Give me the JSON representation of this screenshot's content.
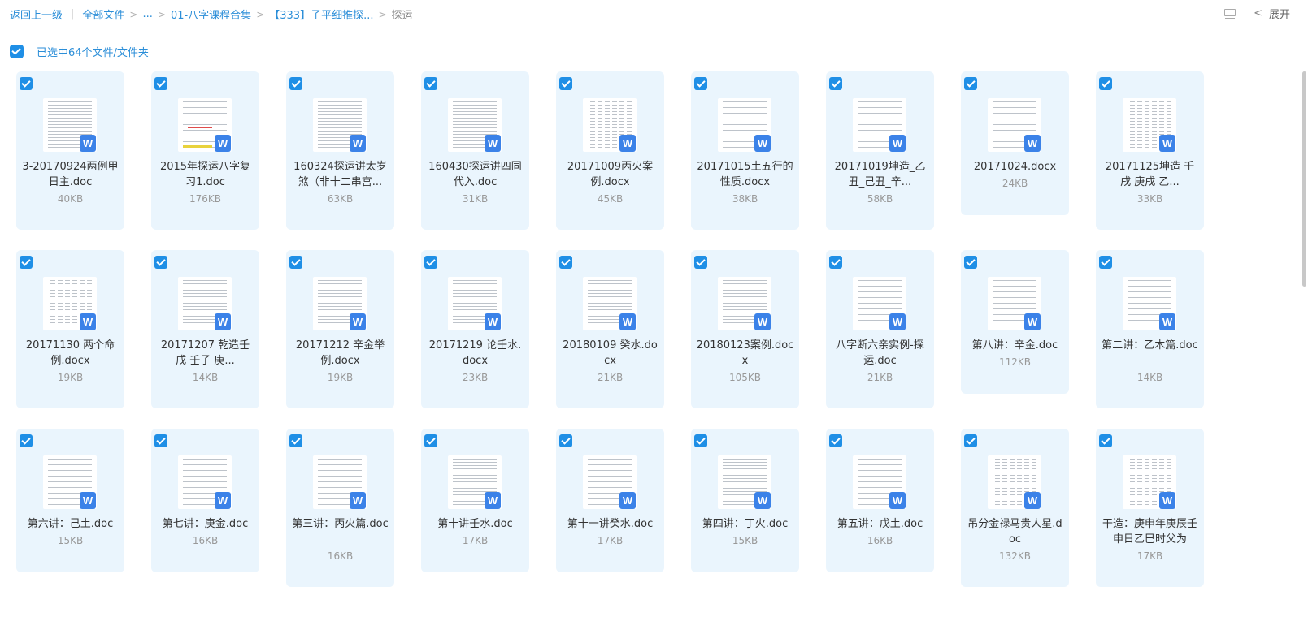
{
  "breadcrumb": {
    "back": "返回上一级",
    "all_files": "全部文件",
    "ellipsis": "...",
    "course": "01-八字课程合集",
    "series": "【333】子平细推探...",
    "current": "探运"
  },
  "header": {
    "expand_label": "展开"
  },
  "selection": {
    "label": "已选中64个文件/文件夹"
  },
  "files": [
    {
      "name": "3-20170924两例甲日主.doc",
      "size": "40KB"
    },
    {
      "name": "2015年探运八字复习1.doc",
      "size": "176KB"
    },
    {
      "name": "160324探运讲太岁煞（非十二串宫...",
      "size": "63KB"
    },
    {
      "name": "160430探运讲四同代入.doc",
      "size": "31KB"
    },
    {
      "name": "20171009丙火案例.docx",
      "size": "45KB"
    },
    {
      "name": "20171015土五行的性质.docx",
      "size": "38KB"
    },
    {
      "name": "20171019坤造_乙丑_己丑_辛...",
      "size": "58KB"
    },
    {
      "name": "20171024.docx",
      "size": "24KB"
    },
    {
      "name": "20171125坤造 壬戌 庚戌 乙...",
      "size": "33KB"
    },
    {
      "name": "20171130 两个命例.docx",
      "size": "19KB"
    },
    {
      "name": "20171207 乾造壬戌 壬子 庚...",
      "size": "14KB"
    },
    {
      "name": "20171212 辛金举例.docx",
      "size": "19KB"
    },
    {
      "name": "20171219 论壬水.docx",
      "size": "23KB"
    },
    {
      "name": "20180109 癸水.docx",
      "size": "21KB"
    },
    {
      "name": "20180123案例.docx",
      "size": "105KB"
    },
    {
      "name": "八字断六亲实例-探运.doc",
      "size": "21KB"
    },
    {
      "name": "第八讲：辛金.doc",
      "size": "112KB"
    },
    {
      "name": "第二讲：乙木篇.doc",
      "size": "14KB"
    },
    {
      "name": "第六讲：己土.doc",
      "size": "15KB"
    },
    {
      "name": "第七讲：庚金.doc",
      "size": "16KB"
    },
    {
      "name": "第三讲：丙火篇.doc",
      "size": "16KB"
    },
    {
      "name": "第十讲壬水.doc",
      "size": "17KB"
    },
    {
      "name": "第十一讲癸水.doc",
      "size": "17KB"
    },
    {
      "name": "第四讲：丁火.doc",
      "size": "15KB"
    },
    {
      "name": "第五讲：戊土.doc",
      "size": "16KB"
    },
    {
      "name": "吊分金禄马贵人星.doc",
      "size": "132KB"
    },
    {
      "name": "干造：庚申年庚辰壬申日乙巳时父为",
      "size": "17KB"
    }
  ]
}
